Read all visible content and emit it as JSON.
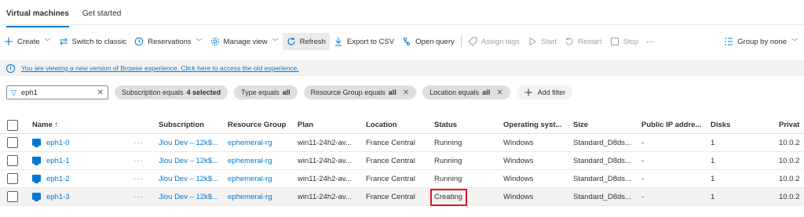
{
  "tabs": [
    {
      "label": "Virtual machines"
    },
    {
      "label": "Get started"
    }
  ],
  "toolbar": {
    "create": "Create",
    "switch_classic": "Switch to classic",
    "reservations": "Reservations",
    "manage_view": "Manage view",
    "refresh": "Refresh",
    "export_csv": "Export to CSV",
    "open_query": "Open query",
    "assign_tags": "Assign tags",
    "start": "Start",
    "restart": "Restart",
    "stop": "Stop",
    "more": "···",
    "group_by": "Group by none"
  },
  "banner": {
    "text": "You are viewing a new version of Browse experience. Click here to access the old experience."
  },
  "filters": {
    "search_value": "eph1",
    "subscription": {
      "prefix": "Subscription equals",
      "value": "4 selected"
    },
    "type": {
      "prefix": "Type equals",
      "value": "all"
    },
    "resource_group": {
      "prefix": "Resource Group equals",
      "value": "all"
    },
    "location": {
      "prefix": "Location equals",
      "value": "all"
    },
    "add_filter": "Add filter"
  },
  "columns": {
    "name": "Name ↑",
    "subscription": "Subscription",
    "resource_group": "Resource Group",
    "plan": "Plan",
    "location": "Location",
    "status": "Status",
    "os": "Operating syst...",
    "size": "Size",
    "public_ip": "Public IP addre...",
    "disks": "Disks",
    "private_ip": "Privat"
  },
  "rows": [
    {
      "name": "eph1-0",
      "more": "···",
      "subscription": "Jlou Dev – 12k$...",
      "resource_group": "ephemeral-rg",
      "plan": "win11-24h2-av...",
      "location": "France Central",
      "status": "Running",
      "os": "Windows",
      "size": "Standard_D8ds...",
      "public_ip": "-",
      "disks": "1",
      "private_ip": "10.0.2"
    },
    {
      "name": "eph1-1",
      "more": "···",
      "subscription": "Jlou Dev – 12k$...",
      "resource_group": "ephemeral-rg",
      "plan": "win11-24h2-av...",
      "location": "France Central",
      "status": "Running",
      "os": "Windows",
      "size": "Standard_D8ds...",
      "public_ip": "-",
      "disks": "1",
      "private_ip": "10.0.2"
    },
    {
      "name": "eph1-2",
      "more": "···",
      "subscription": "Jlou Dev – 12k$...",
      "resource_group": "ephemeral-rg",
      "plan": "win11-24h2-av...",
      "location": "France Central",
      "status": "Running",
      "os": "Windows",
      "size": "Standard_D8ds...",
      "public_ip": "-",
      "disks": "1",
      "private_ip": "10.0.2"
    },
    {
      "name": "eph1-3",
      "more": "···",
      "subscription": "Jlou Dev – 12k$...",
      "resource_group": "ephemeral-rg",
      "plan": "win11-24h2-av...",
      "location": "France Central",
      "status": "Creating",
      "os": "Windows",
      "size": "Standard_D8ds...",
      "public_ip": "-",
      "disks": "1",
      "private_ip": "10.0.2"
    }
  ],
  "colors": {
    "accent": "#0078d4",
    "highlight": "#e81123"
  }
}
